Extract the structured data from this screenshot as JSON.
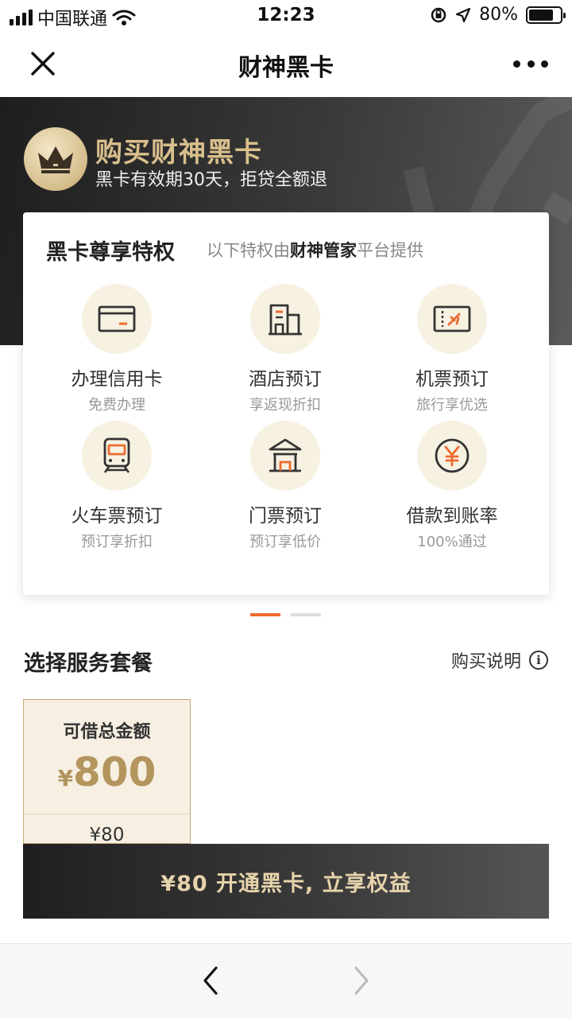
{
  "status_bar": {
    "carrier": "中国联通",
    "time": "12:23",
    "battery": "80%",
    "battery_level": 0.8
  },
  "nav": {
    "title": "财神黑卡"
  },
  "hero": {
    "title": "购买财神黑卡",
    "subtitle": "黑卡有效期30天，拒贷全额退"
  },
  "privileges": {
    "title": "黑卡尊享特权",
    "subtitle_prefix": "以下特权由",
    "subtitle_highlight": "财神管家",
    "subtitle_suffix": "平台提供",
    "items": [
      {
        "label": "办理信用卡",
        "desc": "免费办理",
        "icon": "credit-card-icon"
      },
      {
        "label": "酒店预订",
        "desc": "享返现折扣",
        "icon": "hotel-icon"
      },
      {
        "label": "机票预订",
        "desc": "旅行享优选",
        "icon": "flight-ticket-icon"
      },
      {
        "label": "火车票预订",
        "desc": "预订享折扣",
        "icon": "train-icon"
      },
      {
        "label": "门票预订",
        "desc": "预订享低价",
        "icon": "attraction-icon"
      },
      {
        "label": "借款到账率",
        "desc": "100%通过",
        "icon": "yuan-coin-icon"
      }
    ]
  },
  "carousel": {
    "pages": 2,
    "active": 0
  },
  "plans": {
    "title": "选择服务套餐",
    "help_label": "购买说明",
    "selected": {
      "label": "可借总金额",
      "currency": "¥",
      "amount": "800",
      "price": "¥80"
    }
  },
  "cta": {
    "label": "¥80 开通黑卡, 立享权益"
  },
  "colors": {
    "accent": "#ec6b2e",
    "gold": "#b3955d",
    "gold_light": "#d9bf8c",
    "icon_bg": "#f7f1e2",
    "dark": "#2b2b2b"
  }
}
